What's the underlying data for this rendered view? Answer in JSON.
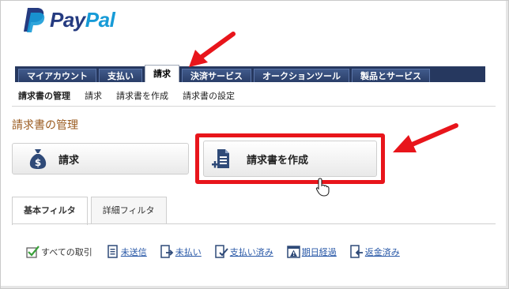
{
  "brand": {
    "name_part1": "Pay",
    "name_part2": "Pal",
    "color_dark": "#253b80",
    "color_light": "#179bd7"
  },
  "main_tabs": [
    {
      "label": "マイアカウント",
      "active": false
    },
    {
      "label": "支払い",
      "active": false
    },
    {
      "label": "請求",
      "active": true
    },
    {
      "label": "決済サービス",
      "active": false
    },
    {
      "label": "オークションツール",
      "active": false
    },
    {
      "label": "製品とサービス",
      "active": false
    }
  ],
  "sub_nav": [
    {
      "label": "請求書の管理",
      "active": true
    },
    {
      "label": "請求",
      "active": false
    },
    {
      "label": "請求書を作成",
      "active": false
    },
    {
      "label": "請求書の設定",
      "active": false
    }
  ],
  "page_title": "請求書の管理",
  "actions": {
    "invoice_label": "請求",
    "invoice_icon": "money-bag-icon",
    "create_label": "請求書を作成",
    "create_icon": "document-add-icon"
  },
  "filter_tabs": [
    {
      "label": "基本フィルタ",
      "active": true
    },
    {
      "label": "詳細フィルタ",
      "active": false
    }
  ],
  "filters": [
    {
      "label": "すべての取引",
      "icon": "check-all-icon"
    },
    {
      "label": "未送信",
      "icon": "document-icon"
    },
    {
      "label": "未払い",
      "icon": "document-arrow-icon"
    },
    {
      "label": "支払い済み",
      "icon": "document-check-icon"
    },
    {
      "label": "期日経過",
      "icon": "calendar-warning-icon"
    },
    {
      "label": "返金済み",
      "icon": "document-return-icon"
    }
  ],
  "colors": {
    "nav_bar": "#26385f",
    "highlight": "#e8151b",
    "title": "#9a5a1e",
    "link": "#2b5aa8"
  }
}
